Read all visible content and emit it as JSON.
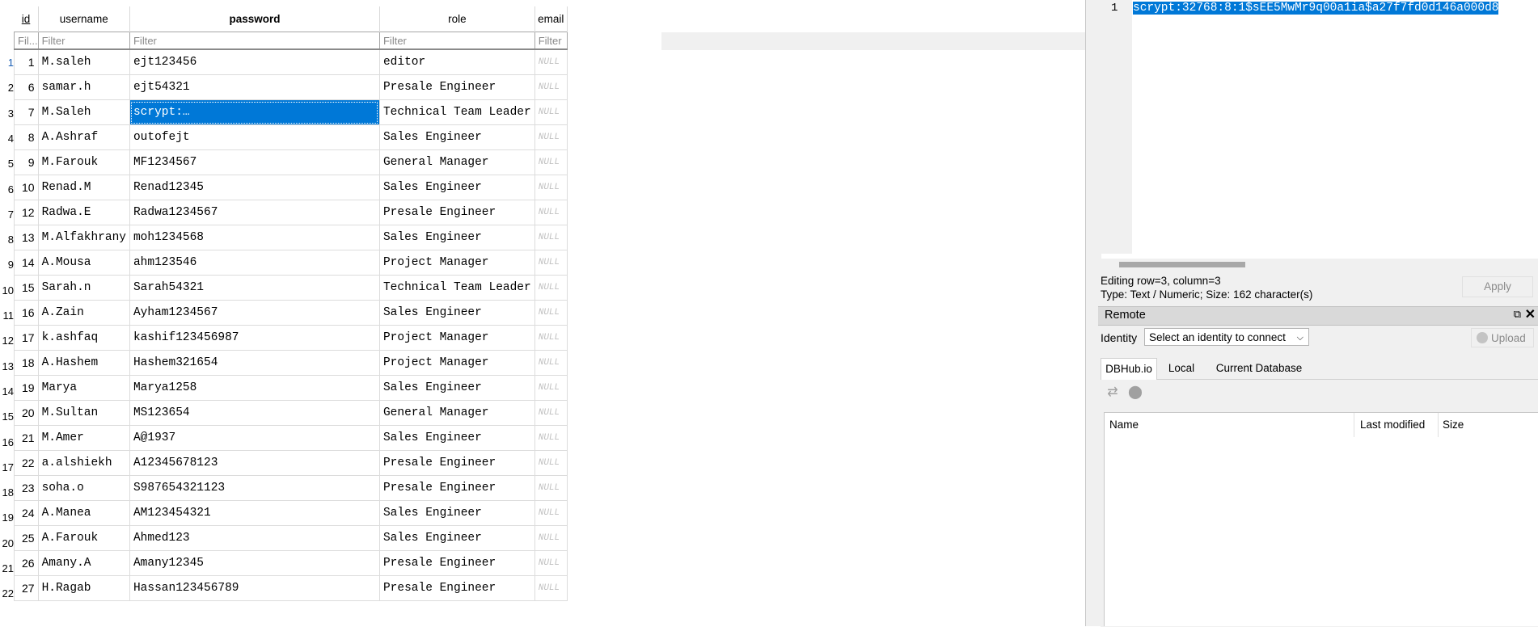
{
  "grid": {
    "columns": [
      "id",
      "username",
      "password",
      "role",
      "email"
    ],
    "filter_placeholders": [
      "Fil...",
      "Filter",
      "Filter",
      "Filter",
      "Filter"
    ],
    "row_numbers": [
      "1",
      "2",
      "3",
      "4",
      "5",
      "6",
      "7",
      "8",
      "9",
      "10",
      "11",
      "12",
      "13",
      "14",
      "15",
      "16",
      "17",
      "18",
      "19",
      "20",
      "21",
      "22"
    ],
    "null_text": "NULL",
    "rows": [
      {
        "id": "1",
        "username": "M.saleh",
        "password": "ejt123456",
        "role": "editor"
      },
      {
        "id": "6",
        "username": "samar.h",
        "password": "ejt54321",
        "role": "Presale Engineer"
      },
      {
        "id": "7",
        "username": "M.Saleh",
        "password": "scrypt:…",
        "role": "Technical Team Leader"
      },
      {
        "id": "8",
        "username": "A.Ashraf",
        "password": "outofejt",
        "role": "Sales Engineer"
      },
      {
        "id": "9",
        "username": "M.Farouk",
        "password": "MF1234567",
        "role": "General Manager"
      },
      {
        "id": "10",
        "username": "Renad.M",
        "password": "Renad12345",
        "role": "Sales Engineer"
      },
      {
        "id": "12",
        "username": "Radwa.E",
        "password": "Radwa1234567",
        "role": "Presale Engineer"
      },
      {
        "id": "13",
        "username": "M.Alfakhrany",
        "password": "moh1234568",
        "role": "Sales Engineer"
      },
      {
        "id": "14",
        "username": "A.Mousa",
        "password": "ahm123546",
        "role": "Project Manager"
      },
      {
        "id": "15",
        "username": "Sarah.n",
        "password": "Sarah54321",
        "role": "Technical Team Leader"
      },
      {
        "id": "16",
        "username": "A.Zain",
        "password": "Ayham1234567",
        "role": "Sales Engineer"
      },
      {
        "id": "17",
        "username": "k.ashfaq",
        "password": "kashif123456987",
        "role": "Project Manager"
      },
      {
        "id": "18",
        "username": "A.Hashem",
        "password": "Hashem321654",
        "role": "Project Manager"
      },
      {
        "id": "19",
        "username": "Marya",
        "password": "Marya1258",
        "role": "Sales Engineer"
      },
      {
        "id": "20",
        "username": "M.Sultan",
        "password": "MS123654",
        "role": "General Manager"
      },
      {
        "id": "21",
        "username": "M.Amer",
        "password": "A@1937",
        "role": "Sales Engineer"
      },
      {
        "id": "22",
        "username": "a.alshiekh",
        "password": "A12345678123",
        "role": "Presale Engineer"
      },
      {
        "id": "23",
        "username": "soha.o",
        "password": "S987654321123",
        "role": "Presale Engineer"
      },
      {
        "id": "24",
        "username": "A.Manea",
        "password": "AM123454321",
        "role": "Sales Engineer"
      },
      {
        "id": "25",
        "username": "A.Farouk",
        "password": "Ahmed123",
        "role": "Sales Engineer"
      },
      {
        "id": "26",
        "username": "Amany.A",
        "password": "Amany12345",
        "role": "Presale Engineer"
      },
      {
        "id": "27",
        "username": "H.Ragab",
        "password": "Hassan123456789",
        "role": "Presale Engineer"
      }
    ],
    "selected_row": 2,
    "selected_column": "password",
    "selection_color": "#0078d7"
  },
  "editor": {
    "line_number": "1",
    "content": "scrypt:32768:8:1$sEE5MwMr9q00a1ia$a27f7fd0d146a000d8",
    "status_line": "Editing row=3, column=3",
    "type_line": "Type: Text / Numeric; Size: 162 character(s)",
    "apply_label": "Apply"
  },
  "remote": {
    "title": "Remote",
    "identity_label": "Identity",
    "identity_placeholder": "Select an identity to connect",
    "upload_label": "Upload",
    "tabs": [
      "DBHub.io",
      "Local",
      "Current Database"
    ],
    "list_columns": [
      "Name",
      "Last modified",
      "Size"
    ],
    "icons": [
      "refresh-icon",
      "clone-icon"
    ]
  }
}
